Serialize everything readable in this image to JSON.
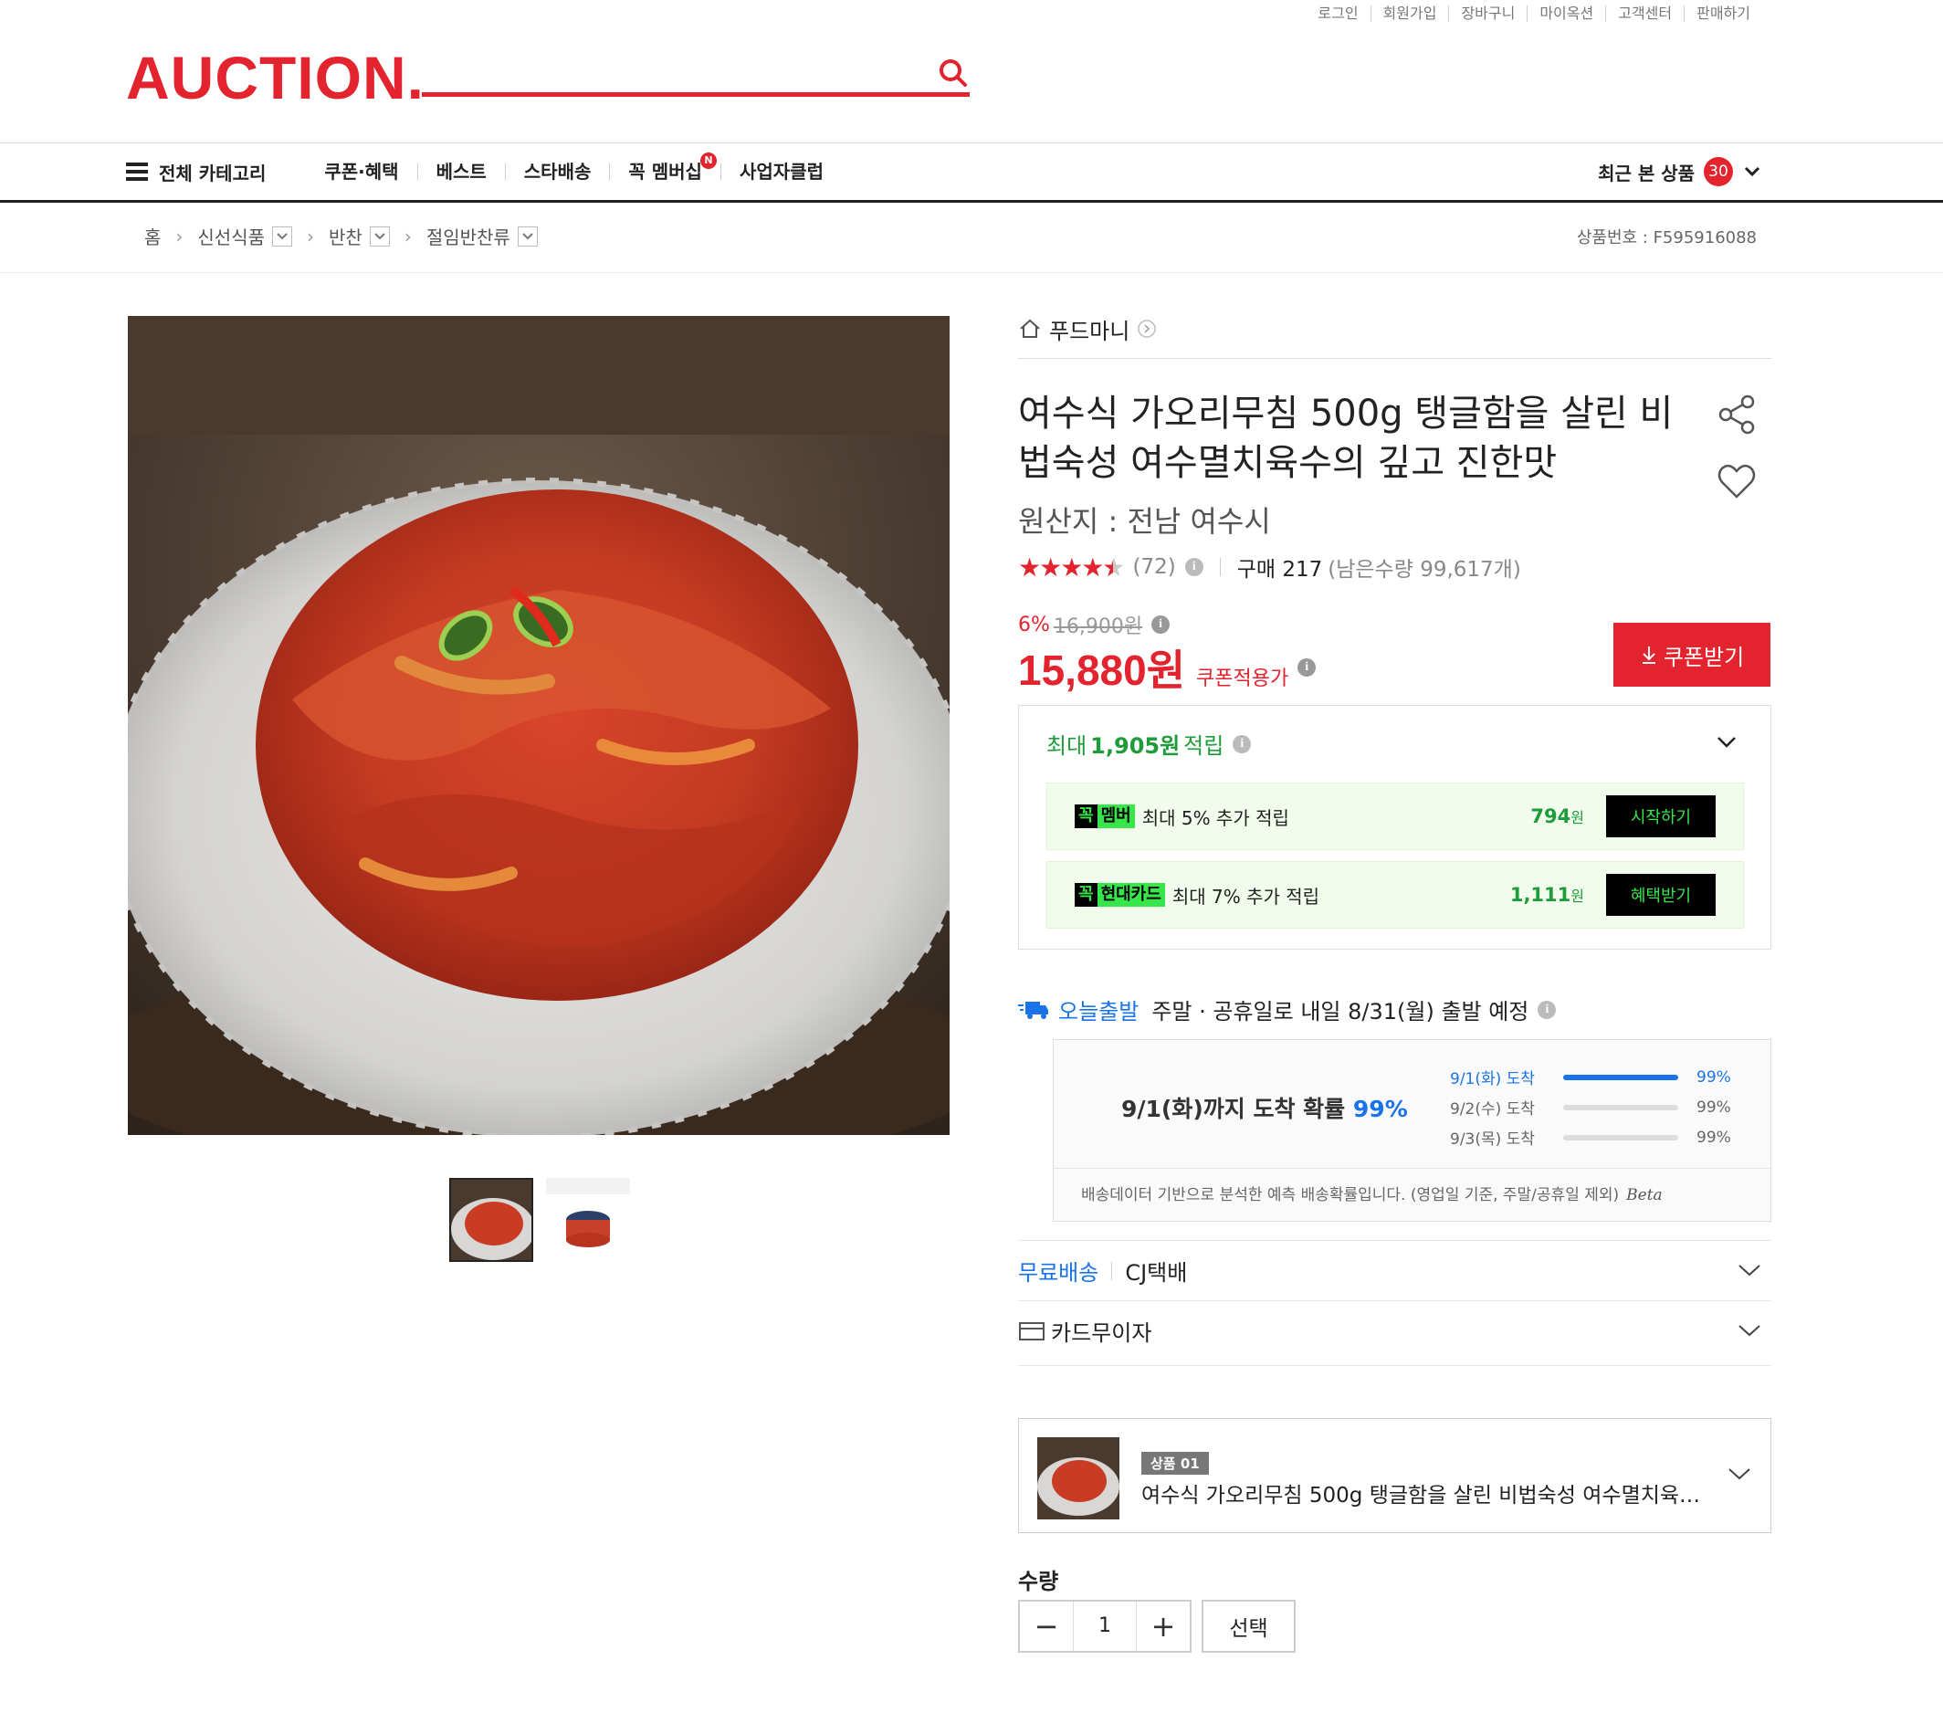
{
  "top_links": [
    "로그인",
    "회원가입",
    "장바구니",
    "마이옥션",
    "고객센터",
    "판매하기"
  ],
  "brand": {
    "logo": "AUCTION.",
    "accent": "#e3232d"
  },
  "search": {
    "placeholder": ""
  },
  "nav": {
    "category_label": "전체 카테고리",
    "items": [
      "쿠폰·혜택",
      "베스트",
      "스타배송",
      "꼭 멤버십",
      "사업자클럽"
    ],
    "membership_badge": "N",
    "recent_label": "최근 본 상품",
    "recent_count": "30"
  },
  "breadcrumb": [
    "홈",
    "신선식품",
    "반찬",
    "절임반찬류"
  ],
  "product_no": "상품번호 : F595916088",
  "seller": "푸드마니",
  "product": {
    "title": "여수식 가오리무침 500g 탱글함을 살린 비법숙성 여수멸치육수의 깊고 진한맛",
    "origin": "원산지 : 전남 여수시",
    "rating_stars": 4.5,
    "review_count": "(72)",
    "purchase": "구매 217",
    "stock": "(남은수량 99,617개)",
    "discount": "6%",
    "original_price": "16,900원",
    "price": "15,880원",
    "price_label": "쿠폰적용가",
    "coupon_button": "쿠폰받기"
  },
  "reward": {
    "headline_prefix": "최대",
    "headline_amount": "1,905원",
    "headline_suffix": "적립",
    "rows": [
      {
        "tag_k": "꼭",
        "tag_n": "멤버",
        "text": "최대 5% 추가 적립",
        "amount": "794",
        "unit": "원",
        "button": "시작하기"
      },
      {
        "tag_k": "꼭",
        "tag_n": "현대카드",
        "text": "최대 7% 추가 적립",
        "amount": "1,111",
        "unit": "원",
        "button": "혜택받기"
      }
    ]
  },
  "shipping": {
    "label": "오늘출발",
    "text": "주말 · 공휴일로 내일 8/31(월) 출발 예정",
    "arrival_main": "9/1(화)까지 도착 확률",
    "arrival_pct": "99%",
    "rows": [
      {
        "date": "9/1(화) 도착",
        "pct": "99%",
        "fill": 1.0
      },
      {
        "date": "9/2(수) 도착",
        "pct": "99%",
        "fill": 0.0
      },
      {
        "date": "9/3(목) 도착",
        "pct": "99%",
        "fill": 0.0
      }
    ],
    "note": "배송데이터 기반으로 분석한 예측 배송확률입니다. (영업일 기준, 주말/공휴일 제외)",
    "beta": "Beta"
  },
  "delivery": {
    "free": "무료배송",
    "carrier": "CJ택배"
  },
  "installment": "카드무이자",
  "option": {
    "tag": "상품 01",
    "name": "여수식 가오리무침 500g 탱글함을 살린 비법숙성 여수멸치육수..."
  },
  "quantity": {
    "label": "수량",
    "value": "1",
    "select": "선택"
  }
}
